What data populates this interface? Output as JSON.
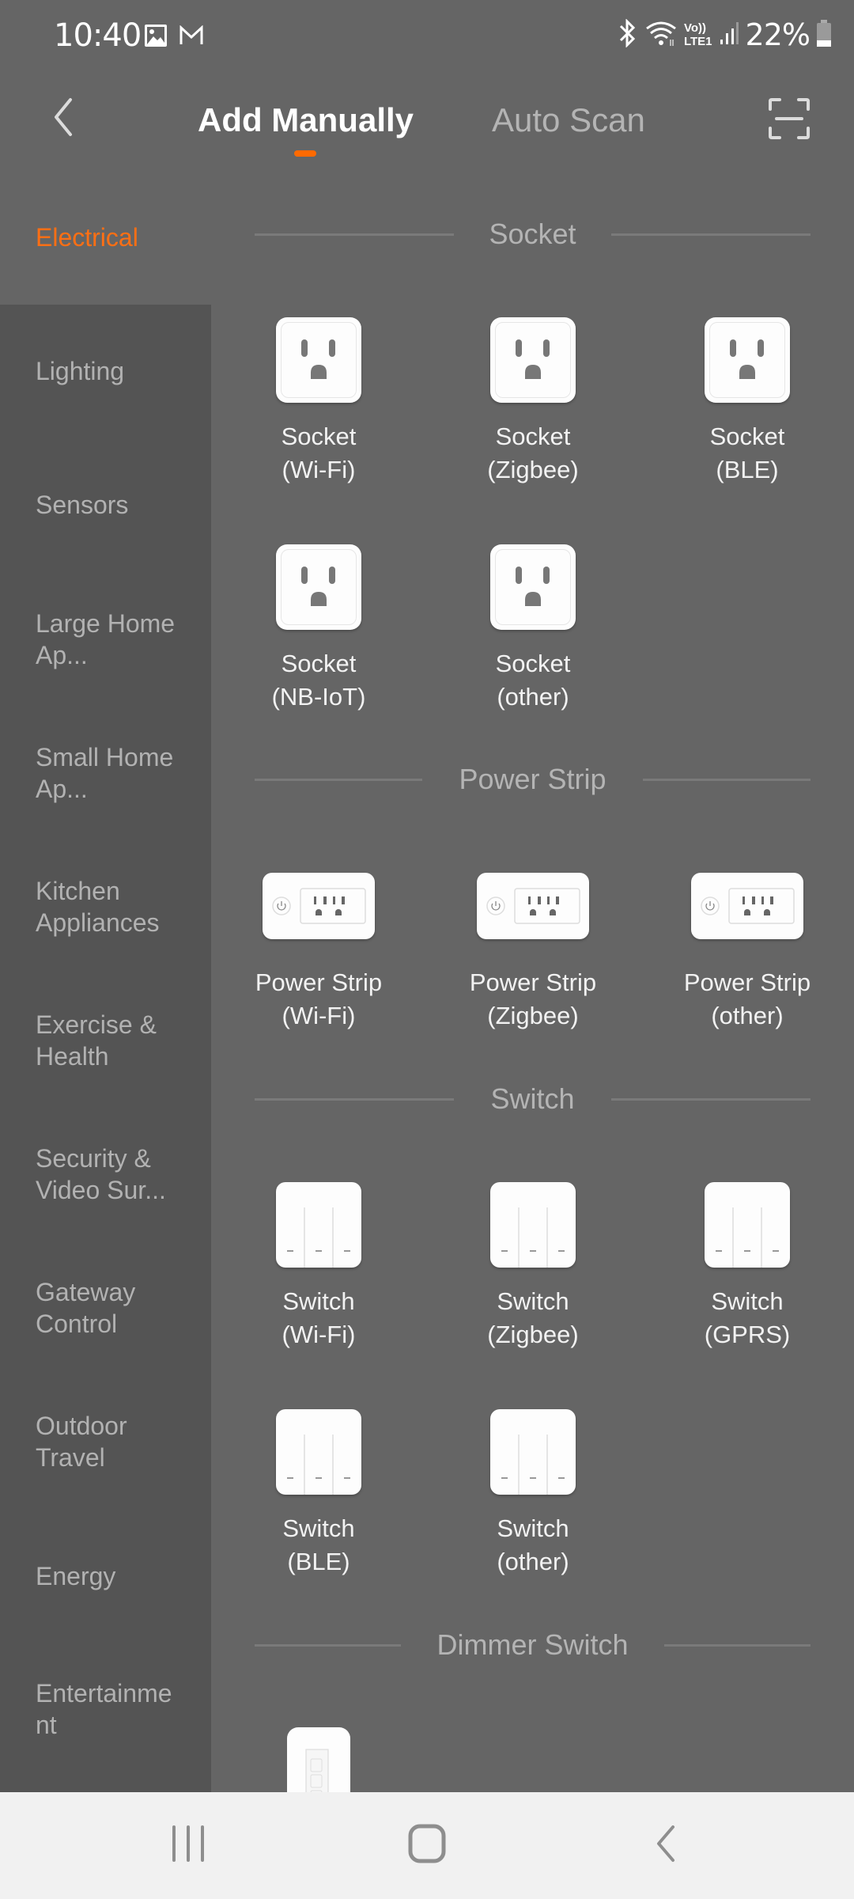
{
  "status_bar": {
    "time": "10:40",
    "left_icons": [
      "gallery-icon",
      "gmail-icon"
    ],
    "right_icons": [
      "bluetooth-icon",
      "wifi-icon",
      "volte-lte-icon",
      "signal-icon"
    ],
    "volte_top": "Vo))",
    "volte_bottom": "LTE1",
    "battery_percent": "22%",
    "battery_level": 0.22
  },
  "header": {
    "back_icon": "chevron-left-icon",
    "tabs": [
      {
        "label": "Add Manually",
        "active": true
      },
      {
        "label": "Auto Scan",
        "active": false
      }
    ],
    "scan_icon": "scan-icon",
    "accent_color": "#ff6a00"
  },
  "sidebar": {
    "items": [
      {
        "label": "Electrical",
        "active": true
      },
      {
        "label": "Lighting"
      },
      {
        "label": "Sensors"
      },
      {
        "label": "Large Home Ap..."
      },
      {
        "label": "Small Home Ap..."
      },
      {
        "label": "Kitchen Appliances"
      },
      {
        "label": "Exercise & Health"
      },
      {
        "label": "Security & Video Sur..."
      },
      {
        "label": "Gateway Control"
      },
      {
        "label": "Outdoor Travel"
      },
      {
        "label": "Energy"
      },
      {
        "label": "Entertainment"
      }
    ]
  },
  "sections": [
    {
      "title": "Socket",
      "devices": [
        {
          "line1": "Socket",
          "line2": "(Wi-Fi)",
          "icon": "socket-icon"
        },
        {
          "line1": "Socket",
          "line2": "(Zigbee)",
          "icon": "socket-icon"
        },
        {
          "line1": "Socket",
          "line2": "(BLE)",
          "icon": "socket-icon"
        },
        {
          "line1": "Socket",
          "line2": "(NB-IoT)",
          "icon": "socket-icon"
        },
        {
          "line1": "Socket",
          "line2": "(other)",
          "icon": "socket-icon"
        }
      ]
    },
    {
      "title": "Power Strip",
      "devices": [
        {
          "line1": "Power Strip",
          "line2": "(Wi-Fi)",
          "icon": "power-strip-icon"
        },
        {
          "line1": "Power Strip",
          "line2": "(Zigbee)",
          "icon": "power-strip-icon"
        },
        {
          "line1": "Power Strip",
          "line2": "(other)",
          "icon": "power-strip-icon"
        }
      ]
    },
    {
      "title": "Switch",
      "devices": [
        {
          "line1": "Switch",
          "line2": "(Wi-Fi)",
          "icon": "switch-icon"
        },
        {
          "line1": "Switch",
          "line2": "(Zigbee)",
          "icon": "switch-icon"
        },
        {
          "line1": "Switch",
          "line2": "(GPRS)",
          "icon": "switch-icon"
        },
        {
          "line1": "Switch",
          "line2": "(BLE)",
          "icon": "switch-icon"
        },
        {
          "line1": "Switch",
          "line2": "(other)",
          "icon": "switch-icon"
        }
      ]
    },
    {
      "title": "Dimmer Switch",
      "devices": [
        {
          "line1": "",
          "line2": "",
          "icon": "dimmer-switch-icon"
        }
      ]
    }
  ],
  "navbar": {
    "recents_icon": "recents-icon",
    "home_icon": "home-icon",
    "back_icon": "back-icon"
  }
}
